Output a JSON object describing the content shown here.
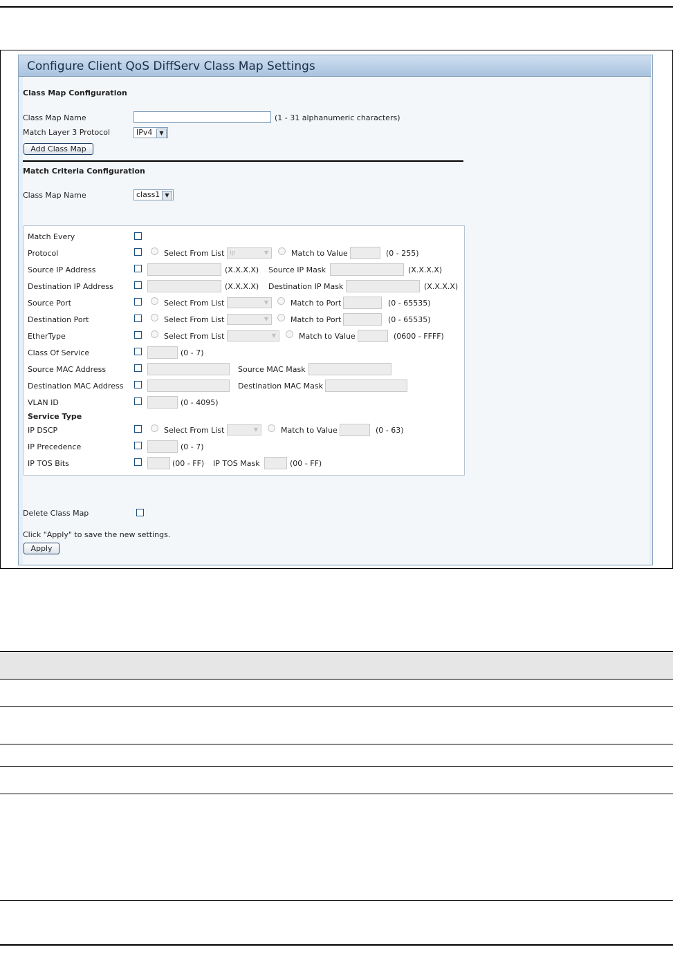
{
  "title": "Configure Client QoS DiffServ Class Map Settings",
  "class_map_config": {
    "heading": "Class Map Configuration",
    "name_label": "Class Map Name",
    "name_hint": "(1 - 31 alphanumeric characters)",
    "protocol_label": "Match Layer 3 Protocol",
    "protocol_value": "IPv4",
    "add_button": "Add Class Map"
  },
  "match_criteria": {
    "heading": "Match Criteria Configuration",
    "name_label": "Class Map Name",
    "name_value": "class1"
  },
  "criteria": {
    "match_every": "Match Every",
    "protocol": "Protocol",
    "source_ip": "Source IP Address",
    "dest_ip": "Destination IP Address",
    "source_port": "Source Port",
    "dest_port": "Destination Port",
    "ethertype": "EtherType",
    "cos": "Class Of Service",
    "source_mac": "Source MAC Address",
    "dest_mac": "Destination MAC Address",
    "vlan": "VLAN ID",
    "service_type": "Service Type",
    "ip_dscp": "IP DSCP",
    "ip_precedence": "IP Precedence",
    "ip_tos": "IP TOS Bits"
  },
  "texts": {
    "select_from_list": "Select From List",
    "match_to_value": "Match to Value",
    "match_to_port": "Match to Port",
    "range_0_255": "(0 - 255)",
    "ip_format": "(X.X.X.X)",
    "source_ip_mask": "Source IP Mask",
    "dest_ip_mask": "Destination IP Mask",
    "range_0_65535": "(0 - 65535)",
    "range_ether": "(0600 - FFFF)",
    "range_0_7": "(0 - 7)",
    "source_mac_mask": "Source MAC Mask",
    "dest_mac_mask": "Destination MAC Mask",
    "range_0_4095": "(0 - 4095)",
    "range_0_63": "(0 - 63)",
    "range_00_ff": "(00 - FF)",
    "ip_tos_mask": "IP TOS Mask",
    "protocol_list_value": "ip"
  },
  "footer": {
    "delete_label": "Delete Class Map",
    "apply_note": "Click \"Apply\" to save the new settings.",
    "apply_button": "Apply"
  }
}
